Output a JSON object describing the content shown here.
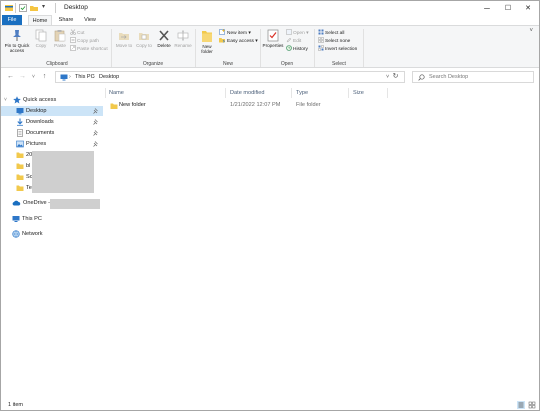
{
  "window": {
    "title": "Desktop"
  },
  "quick_access_toolbar": {
    "dropdown_glyph": "▾"
  },
  "window_controls": {
    "minimize": "─",
    "maximize": "☐",
    "close": "✕"
  },
  "tabs": [
    {
      "label": "File"
    },
    {
      "label": "Home"
    },
    {
      "label": "Share"
    },
    {
      "label": "View"
    }
  ],
  "ribbon": {
    "expand_glyph": "˅",
    "clipboard": {
      "label": "Clipboard",
      "pin_quick_access": "Pin to Quick access",
      "copy": "Copy",
      "paste": "Paste",
      "cut": "Cut",
      "copy_path": "Copy path",
      "paste_shortcut": "Paste shortcut"
    },
    "organize": {
      "label": "Organize",
      "move_to": "Move to",
      "copy_to": "Copy to",
      "delete": "Delete",
      "rename": "Rename"
    },
    "new": {
      "label": "New",
      "new_folder": "New folder",
      "new_item": "New item",
      "easy_access": "Easy access"
    },
    "open": {
      "label": "Open",
      "properties": "Properties",
      "open": "Open",
      "edit": "Edit",
      "history": "History"
    },
    "select": {
      "label": "Select",
      "select_all": "Select all",
      "select_none": "Select none",
      "invert_selection": "Invert selection"
    }
  },
  "address_bar": {
    "breadcrumbs": [
      "This PC",
      "Desktop"
    ],
    "separator": "›",
    "search_placeholder": "Search Desktop"
  },
  "nav_pane": {
    "quick_access": "Quick access",
    "items": [
      {
        "label": "Desktop",
        "pinned": true,
        "selected": true
      },
      {
        "label": "Downloads",
        "pinned": true
      },
      {
        "label": "Documents",
        "pinned": true
      },
      {
        "label": "Pictures",
        "pinned": true
      }
    ],
    "partial_items": [
      "20",
      "bl",
      "Sc",
      "Te"
    ],
    "onedrive": "OneDrive -",
    "this_pc": "This PC",
    "network": "Network"
  },
  "columns": [
    "Name",
    "Date modified",
    "Type",
    "Size"
  ],
  "files": [
    {
      "name": "New folder",
      "date_modified": "1/21/2022 12:07 PM",
      "type": "File folder",
      "size": ""
    }
  ],
  "status": {
    "item_count": "1 item"
  },
  "colors": {
    "accent": "#1a6fc0",
    "selection": "#cce4f7",
    "folder": "#f2c94c",
    "ribbon_bg": "#f5f6f7"
  }
}
